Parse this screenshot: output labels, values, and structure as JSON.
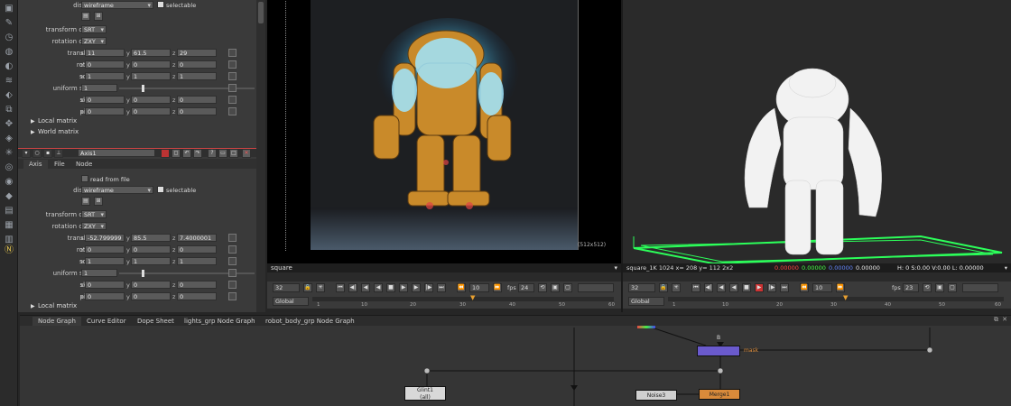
{
  "toolbar": {
    "icons": [
      "image-icon",
      "draw-icon",
      "time-icon",
      "channel-icon",
      "color-icon",
      "filter-icon",
      "keyer-icon",
      "merge-icon",
      "transform-icon",
      "3d-icon",
      "particles-icon",
      "deep-icon",
      "views-icon",
      "metadata-icon",
      "toolsets-icon",
      "other-icon",
      "furnace-icon",
      "nuke-logo-icon"
    ]
  },
  "props": {
    "top_card": {
      "display_label": "display",
      "display_value": "wireframe",
      "selectable_label": "selectable",
      "transform_order_label": "transform order",
      "transform_order_value": "SRT",
      "rotation_order_label": "rotation order",
      "rotation_order_value": "ZXY",
      "translate_label": "translate",
      "translate": {
        "x": "11",
        "y": "61.5",
        "z": "29"
      },
      "rotate_label": "rotate",
      "rotate": {
        "x": "0",
        "y": "0",
        "z": "0"
      },
      "scale_label": "scale",
      "scale": {
        "x": "1",
        "y": "1",
        "z": "1"
      },
      "uniform_scale_label": "uniform scale",
      "uniform_scale_value": "1",
      "skew_label": "skew",
      "skew": {
        "x": "0",
        "y": "0",
        "z": "0"
      },
      "pivot_label": "pivot",
      "pivot": {
        "x": "0",
        "y": "0",
        "z": "0"
      },
      "local_matrix": "Local matrix",
      "world_matrix": "World matrix"
    },
    "axis_card": {
      "node_name": "Axis1",
      "tabs": [
        "Axis",
        "File",
        "Node"
      ],
      "read_from_file": "read from file",
      "display_label": "display",
      "display_value": "wireframe",
      "selectable_label": "selectable",
      "transform_order_label": "transform order",
      "transform_order_value": "SRT",
      "rotation_order_label": "rotation order",
      "rotation_order_value": "ZXY",
      "translate_label": "translate",
      "translate": {
        "x": "-52.799999",
        "y": "85.5",
        "z": "7.4000001"
      },
      "rotate_label": "rotate",
      "rotate": {
        "x": "0",
        "y": "0",
        "z": "0"
      },
      "scale_label": "scale",
      "scale": {
        "x": "1",
        "y": "1",
        "z": "1"
      },
      "uniform_scale_label": "uniform scale",
      "uniform_scale_value": "1",
      "skew_label": "skew",
      "skew": {
        "x": "0",
        "y": "0",
        "z": "0"
      },
      "pivot_label": "pivot",
      "pivot": {
        "x": "0",
        "y": "0",
        "z": "0"
      },
      "local_matrix": "Local matrix"
    },
    "axis_labels": {
      "x": "x",
      "y": "y",
      "z": "z"
    },
    "slider_ticks": [
      "0",
      "0.5",
      "1",
      "1.5",
      "2",
      "2.5",
      "3",
      "3.5",
      "4"
    ]
  },
  "viewer_left": {
    "format_badge": "(512x512)",
    "bottom_label": "square",
    "frame": "32",
    "fps_label": "fps",
    "fps": "24",
    "increment": "10",
    "range_mode": "Global",
    "timeline_start": "1",
    "timeline_ticks": [
      "10",
      "20",
      "30",
      "40",
      "50",
      "60"
    ],
    "timeline_end": "60"
  },
  "viewer_right": {
    "info": "square_1K 1024  x= 208 y= 112   2x2",
    "color_values": [
      "0.00000",
      "0.00000",
      "0.00000",
      "0.00000"
    ],
    "hsv": "H: 0 S:0.00 V:0.00   L: 0.00000",
    "frame": "32",
    "fps_label": "fps",
    "fps": "23",
    "increment": "10",
    "range_mode": "Global",
    "timeline_start": "1",
    "timeline_ticks": [
      "10",
      "20",
      "30",
      "40",
      "50",
      "60"
    ],
    "timeline_end": "60"
  },
  "node_graph_tabs": [
    "Node Graph",
    "Curve Editor",
    "Dope Sheet",
    "lights_grp Node Graph",
    "robot_body_grp Node Graph"
  ],
  "node_graph": {
    "glint_node": "Glint1",
    "glint_sub": "(all)",
    "noise_node": "Noise3",
    "merge_node": "Merge1",
    "mask_label": "mask",
    "b_label": "B"
  },
  "colors": {
    "accent_red": "#cc3333",
    "wire_green": "#33ff66",
    "red_value": "#ff3333",
    "green_value": "#33ff33",
    "blue_value": "#5577ff",
    "node_purple": "#6a5acd",
    "node_orange": "#d98a3a"
  }
}
